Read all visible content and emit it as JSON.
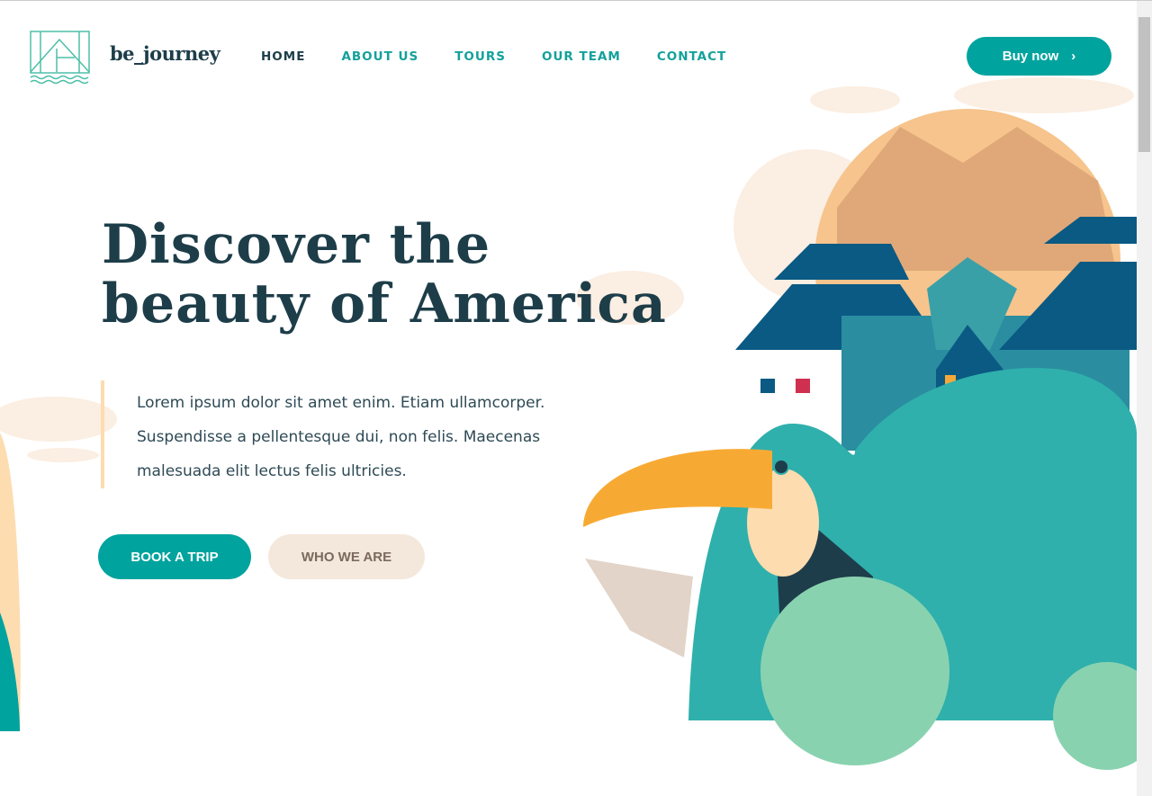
{
  "brand": {
    "name": "be_journey"
  },
  "nav": {
    "items": [
      {
        "label": "HOME"
      },
      {
        "label": "ABOUT US"
      },
      {
        "label": "TOURS"
      },
      {
        "label": "OUR TEAM"
      },
      {
        "label": "CONTACT"
      }
    ]
  },
  "header": {
    "buy_label": "Buy now",
    "buy_icon": "chevron-right-icon"
  },
  "hero": {
    "title_line1": "Discover the",
    "title_line2": "beauty of America",
    "body": "Lorem ipsum dolor sit amet enim. Etiam ullamcorper. Suspendisse a pellentesque dui, non felis. Maecenas malesuada elit lectus felis ultricies.",
    "book_label": "BOOK A TRIP",
    "who_label": "WHO WE ARE"
  },
  "colors": {
    "accent": "#00a39e",
    "dark": "#1d3d49",
    "beige": "#f4e8dc"
  }
}
